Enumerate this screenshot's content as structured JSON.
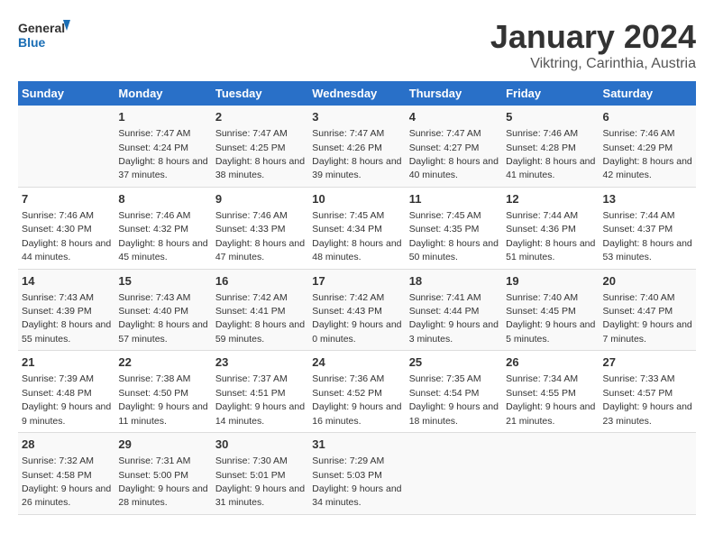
{
  "logo": {
    "line1": "General",
    "line2": "Blue"
  },
  "title": "January 2024",
  "subtitle": "Viktring, Carinthia, Austria",
  "weekdays": [
    "Sunday",
    "Monday",
    "Tuesday",
    "Wednesday",
    "Thursday",
    "Friday",
    "Saturday"
  ],
  "weeks": [
    [
      {
        "day": "",
        "sunrise": "",
        "sunset": "",
        "daylight": ""
      },
      {
        "day": "1",
        "sunrise": "Sunrise: 7:47 AM",
        "sunset": "Sunset: 4:24 PM",
        "daylight": "Daylight: 8 hours and 37 minutes."
      },
      {
        "day": "2",
        "sunrise": "Sunrise: 7:47 AM",
        "sunset": "Sunset: 4:25 PM",
        "daylight": "Daylight: 8 hours and 38 minutes."
      },
      {
        "day": "3",
        "sunrise": "Sunrise: 7:47 AM",
        "sunset": "Sunset: 4:26 PM",
        "daylight": "Daylight: 8 hours and 39 minutes."
      },
      {
        "day": "4",
        "sunrise": "Sunrise: 7:47 AM",
        "sunset": "Sunset: 4:27 PM",
        "daylight": "Daylight: 8 hours and 40 minutes."
      },
      {
        "day": "5",
        "sunrise": "Sunrise: 7:46 AM",
        "sunset": "Sunset: 4:28 PM",
        "daylight": "Daylight: 8 hours and 41 minutes."
      },
      {
        "day": "6",
        "sunrise": "Sunrise: 7:46 AM",
        "sunset": "Sunset: 4:29 PM",
        "daylight": "Daylight: 8 hours and 42 minutes."
      }
    ],
    [
      {
        "day": "7",
        "sunrise": "Sunrise: 7:46 AM",
        "sunset": "Sunset: 4:30 PM",
        "daylight": "Daylight: 8 hours and 44 minutes."
      },
      {
        "day": "8",
        "sunrise": "Sunrise: 7:46 AM",
        "sunset": "Sunset: 4:32 PM",
        "daylight": "Daylight: 8 hours and 45 minutes."
      },
      {
        "day": "9",
        "sunrise": "Sunrise: 7:46 AM",
        "sunset": "Sunset: 4:33 PM",
        "daylight": "Daylight: 8 hours and 47 minutes."
      },
      {
        "day": "10",
        "sunrise": "Sunrise: 7:45 AM",
        "sunset": "Sunset: 4:34 PM",
        "daylight": "Daylight: 8 hours and 48 minutes."
      },
      {
        "day": "11",
        "sunrise": "Sunrise: 7:45 AM",
        "sunset": "Sunset: 4:35 PM",
        "daylight": "Daylight: 8 hours and 50 minutes."
      },
      {
        "day": "12",
        "sunrise": "Sunrise: 7:44 AM",
        "sunset": "Sunset: 4:36 PM",
        "daylight": "Daylight: 8 hours and 51 minutes."
      },
      {
        "day": "13",
        "sunrise": "Sunrise: 7:44 AM",
        "sunset": "Sunset: 4:37 PM",
        "daylight": "Daylight: 8 hours and 53 minutes."
      }
    ],
    [
      {
        "day": "14",
        "sunrise": "Sunrise: 7:43 AM",
        "sunset": "Sunset: 4:39 PM",
        "daylight": "Daylight: 8 hours and 55 minutes."
      },
      {
        "day": "15",
        "sunrise": "Sunrise: 7:43 AM",
        "sunset": "Sunset: 4:40 PM",
        "daylight": "Daylight: 8 hours and 57 minutes."
      },
      {
        "day": "16",
        "sunrise": "Sunrise: 7:42 AM",
        "sunset": "Sunset: 4:41 PM",
        "daylight": "Daylight: 8 hours and 59 minutes."
      },
      {
        "day": "17",
        "sunrise": "Sunrise: 7:42 AM",
        "sunset": "Sunset: 4:43 PM",
        "daylight": "Daylight: 9 hours and 0 minutes."
      },
      {
        "day": "18",
        "sunrise": "Sunrise: 7:41 AM",
        "sunset": "Sunset: 4:44 PM",
        "daylight": "Daylight: 9 hours and 3 minutes."
      },
      {
        "day": "19",
        "sunrise": "Sunrise: 7:40 AM",
        "sunset": "Sunset: 4:45 PM",
        "daylight": "Daylight: 9 hours and 5 minutes."
      },
      {
        "day": "20",
        "sunrise": "Sunrise: 7:40 AM",
        "sunset": "Sunset: 4:47 PM",
        "daylight": "Daylight: 9 hours and 7 minutes."
      }
    ],
    [
      {
        "day": "21",
        "sunrise": "Sunrise: 7:39 AM",
        "sunset": "Sunset: 4:48 PM",
        "daylight": "Daylight: 9 hours and 9 minutes."
      },
      {
        "day": "22",
        "sunrise": "Sunrise: 7:38 AM",
        "sunset": "Sunset: 4:50 PM",
        "daylight": "Daylight: 9 hours and 11 minutes."
      },
      {
        "day": "23",
        "sunrise": "Sunrise: 7:37 AM",
        "sunset": "Sunset: 4:51 PM",
        "daylight": "Daylight: 9 hours and 14 minutes."
      },
      {
        "day": "24",
        "sunrise": "Sunrise: 7:36 AM",
        "sunset": "Sunset: 4:52 PM",
        "daylight": "Daylight: 9 hours and 16 minutes."
      },
      {
        "day": "25",
        "sunrise": "Sunrise: 7:35 AM",
        "sunset": "Sunset: 4:54 PM",
        "daylight": "Daylight: 9 hours and 18 minutes."
      },
      {
        "day": "26",
        "sunrise": "Sunrise: 7:34 AM",
        "sunset": "Sunset: 4:55 PM",
        "daylight": "Daylight: 9 hours and 21 minutes."
      },
      {
        "day": "27",
        "sunrise": "Sunrise: 7:33 AM",
        "sunset": "Sunset: 4:57 PM",
        "daylight": "Daylight: 9 hours and 23 minutes."
      }
    ],
    [
      {
        "day": "28",
        "sunrise": "Sunrise: 7:32 AM",
        "sunset": "Sunset: 4:58 PM",
        "daylight": "Daylight: 9 hours and 26 minutes."
      },
      {
        "day": "29",
        "sunrise": "Sunrise: 7:31 AM",
        "sunset": "Sunset: 5:00 PM",
        "daylight": "Daylight: 9 hours and 28 minutes."
      },
      {
        "day": "30",
        "sunrise": "Sunrise: 7:30 AM",
        "sunset": "Sunset: 5:01 PM",
        "daylight": "Daylight: 9 hours and 31 minutes."
      },
      {
        "day": "31",
        "sunrise": "Sunrise: 7:29 AM",
        "sunset": "Sunset: 5:03 PM",
        "daylight": "Daylight: 9 hours and 34 minutes."
      },
      {
        "day": "",
        "sunrise": "",
        "sunset": "",
        "daylight": ""
      },
      {
        "day": "",
        "sunrise": "",
        "sunset": "",
        "daylight": ""
      },
      {
        "day": "",
        "sunrise": "",
        "sunset": "",
        "daylight": ""
      }
    ]
  ]
}
